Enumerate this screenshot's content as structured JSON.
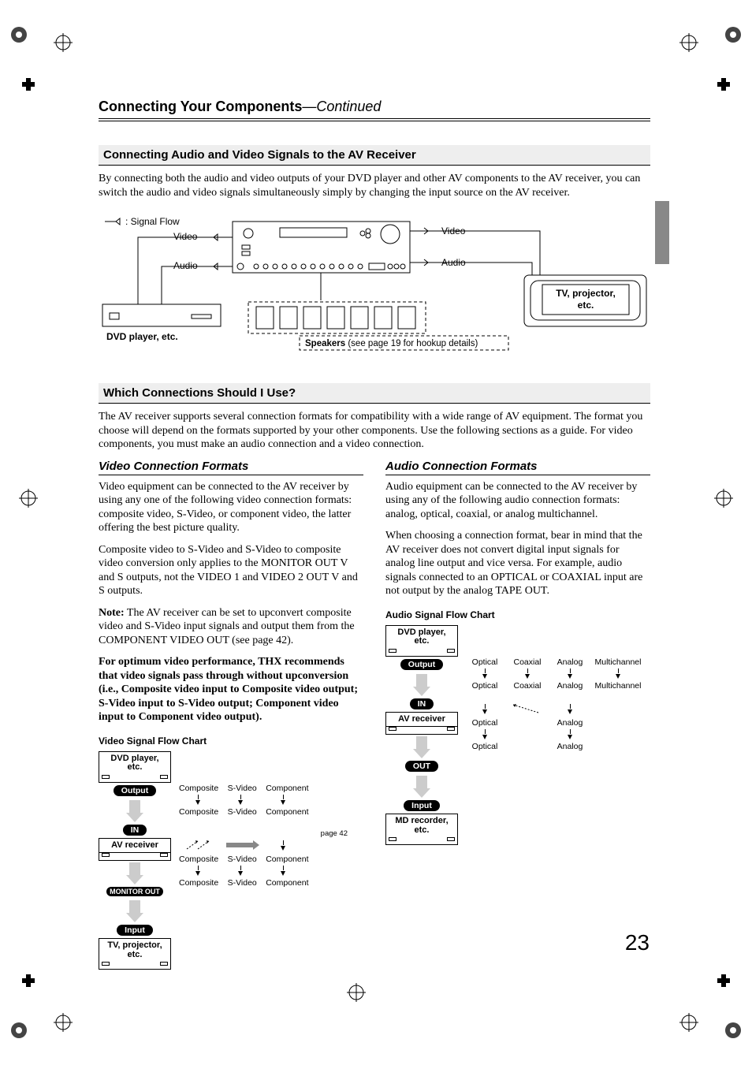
{
  "page_number": "23",
  "chapter": {
    "title": "Connecting Your Components",
    "continued": "—Continued"
  },
  "section1": {
    "heading": "Connecting Audio and Video Signals to the AV Receiver",
    "para": "By connecting both the audio and video outputs of your DVD player and other AV components to the AV receiver, you can switch the audio and video signals simultaneously simply by changing the input source on the AV receiver."
  },
  "diagram1": {
    "legend": ": Signal Flow",
    "video": "Video",
    "audio": "Audio",
    "dvd": "DVD player, etc.",
    "tv": "TV, projector, etc.",
    "speakers_label": "Speakers",
    "speakers_note": " (see page 19 for hookup details)"
  },
  "section2": {
    "heading": "Which Connections Should I Use?",
    "para": "The AV receiver supports several connection formats for compatibility with a wide range of AV equipment. The format you choose will depend on the formats supported by your other components. Use the following sections as a guide. For video components, you must make an audio connection and a video connection."
  },
  "video_col": {
    "heading": "Video Connection Formats",
    "p1": "Video equipment can be connected to the AV receiver by using any one of the following video connection formats: composite video, S-Video, or component video, the latter offering the best picture quality.",
    "p2": "Composite video to S-Video and S-Video to composite video conversion only applies to the MONITOR OUT V and S outputs, not the VIDEO 1 and VIDEO 2 OUT V and S outputs.",
    "p3_label": "Note:",
    "p3": " The AV receiver can be set to upconvert composite video and S-Video input signals and output them from the COMPONENT VIDEO OUT (see page 42).",
    "p4": "For optimum video performance, THX recommends that video signals pass through without upconversion (i.e., Composite video input to Composite video output; S-Video input to S-Video output; Component video input to Component video output).",
    "chart_title": "Video Signal Flow Chart",
    "flow": {
      "dvd": "DVD player, etc.",
      "output": "Output",
      "in": "IN",
      "avr": "AV receiver",
      "monitor_out": "MONITOR OUT",
      "input": "Input",
      "tv": "TV, projector, etc.",
      "labels": [
        "Composite",
        "S-Video",
        "Component"
      ],
      "page42": "page 42"
    }
  },
  "audio_col": {
    "heading": "Audio Connection Formats",
    "p1": "Audio equipment can be connected to the AV receiver by using any of the following audio connection formats: analog, optical, coaxial, or analog multichannel.",
    "p2": "When choosing a connection format, bear in mind that the AV receiver does not convert digital input signals for analog line output and vice versa. For example, audio signals connected to an OPTICAL or COAXIAL input are not output by the analog TAPE OUT.",
    "chart_title": "Audio Signal Flow Chart",
    "flow": {
      "dvd": "DVD player, etc.",
      "output": "Output",
      "in": "IN",
      "avr": "AV receiver",
      "out": "OUT",
      "input": "Input",
      "md": "MD recorder, etc.",
      "labels_top": [
        "Optical",
        "Coaxial",
        "Analog",
        "Multichannel"
      ],
      "labels_bot": [
        "Optical",
        "Analog"
      ]
    }
  }
}
